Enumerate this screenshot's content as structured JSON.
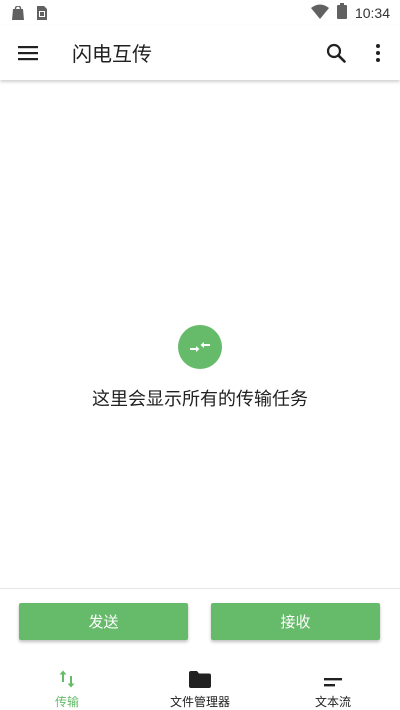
{
  "status_bar": {
    "time": "10:34",
    "icons": [
      "shopping-bag-icon",
      "sim-card-icon",
      "wifi-icon",
      "battery-icon"
    ]
  },
  "app_bar": {
    "title": "闪电互传",
    "icons": [
      "menu-icon",
      "search-icon",
      "more-vert-icon"
    ]
  },
  "empty_state": {
    "message": "这里会显示所有的传输任务",
    "icon": "transfer-arrows-icon"
  },
  "actions": {
    "send_label": "发送",
    "receive_label": "接收"
  },
  "bottom_nav": {
    "items": [
      {
        "label": "传输",
        "icon": "swap-vertical-icon",
        "active": true
      },
      {
        "label": "文件管理器",
        "icon": "folder-icon",
        "active": false
      },
      {
        "label": "文本流",
        "icon": "short-text-icon",
        "active": false
      }
    ]
  },
  "colors": {
    "accent": "#66bb6a",
    "text": "#212121",
    "icon_dark": "#424242"
  }
}
